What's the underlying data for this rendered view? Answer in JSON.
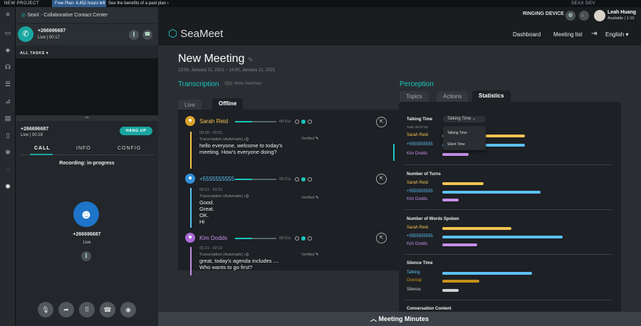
{
  "topbar": {
    "project": "NEW PROJECT",
    "free_plan": "Free Plan:",
    "hours_left": "4,452 hours left",
    "benefits": "See the benefits of a paid plan",
    "env": "SEAX DEV"
  },
  "cc": {
    "title": "SeaX - Collaborative Contact Center",
    "active_call": {
      "number": "+266696687",
      "status": "Live",
      "time": "00:17"
    },
    "all_tasks": "ALL TASKS",
    "detail": {
      "number": "+266696687",
      "status": "Live",
      "time": "00:18",
      "hangup": "HANG UP",
      "tabs": [
        "CALL",
        "INFO",
        "CONFIG"
      ],
      "recording": "Recording: in-progress",
      "contact": "+266696687",
      "contact_status": "Live"
    }
  },
  "header": {
    "ringing": "RINGING DEVICE",
    "logo": "SeaMeet",
    "nav": [
      "Dashboard",
      "Meeting list",
      "English"
    ],
    "user": {
      "name": "Leah Huang",
      "status": "Available",
      "time": "1:10"
    }
  },
  "meeting": {
    "title": "New Meeting",
    "date": "13:50, January 21, 2021 ~ 14:00, January 21, 2021",
    "transcription_h": "Transcription",
    "show_summary": "Show Summary",
    "tabs": [
      "Live",
      "Offline"
    ],
    "entries": [
      {
        "name": "Sarah Reid",
        "dur": "00:51s",
        "range": "00:00 - 00:51",
        "auto": "Transcription (Automatic)",
        "verified": "Verified",
        "lines": [
          "hello everyone, welcome to today's",
          "meeting. How's everyone doing?"
        ]
      },
      {
        "name": "+5555555555",
        "dur": "00:21s",
        "range": "00:51 - 01:21",
        "auto": "Transcription (Automatic)",
        "verified": "Verified",
        "lines": [
          "Good.",
          "Great.",
          "OK.",
          "Hi"
        ]
      },
      {
        "name": "Kim Dodds",
        "dur": "00:51s",
        "range": "01:21 - 02:12",
        "auto": "Transcription (Automatic)",
        "verified": "Verified",
        "lines": [
          "great, today's agenda includes ....",
          "Who wants to go first?"
        ]
      }
    ],
    "perception_h": "Perception",
    "perc_tabs": [
      "Topics",
      "Actions",
      "Statistics"
    ],
    "stats": {
      "talking_time": "Talking Time",
      "dropdown": "Talking Time",
      "total": "Total: 00:07:22",
      "menu": [
        "Talking Time",
        "Silent Time"
      ],
      "people": [
        "Sarah Reid",
        "+5555555555",
        "Kim Dodds"
      ],
      "turns": "Number of Turns",
      "words": "Number of Words Spoken",
      "silence": "Silence Time",
      "silence_items": [
        "Talking",
        "Overlap",
        "Silence"
      ],
      "content": "Conversation Content",
      "values": {
        "talking_time": [
          0.6,
          0.6,
          0.19
        ],
        "turns": [
          0.3,
          0.71,
          0.12
        ],
        "words": [
          0.5,
          0.87,
          0.25
        ],
        "silence": [
          0.65,
          0.27,
          0.12
        ]
      }
    },
    "minutes": "Meeting Minutes"
  },
  "colors": {
    "accent": "#19c6c0",
    "sarah": "#f5c451",
    "phone": "#5cc0f5",
    "kim": "#c58ee8",
    "overlap": "#c7901a",
    "silence": "#cfcfcf"
  }
}
